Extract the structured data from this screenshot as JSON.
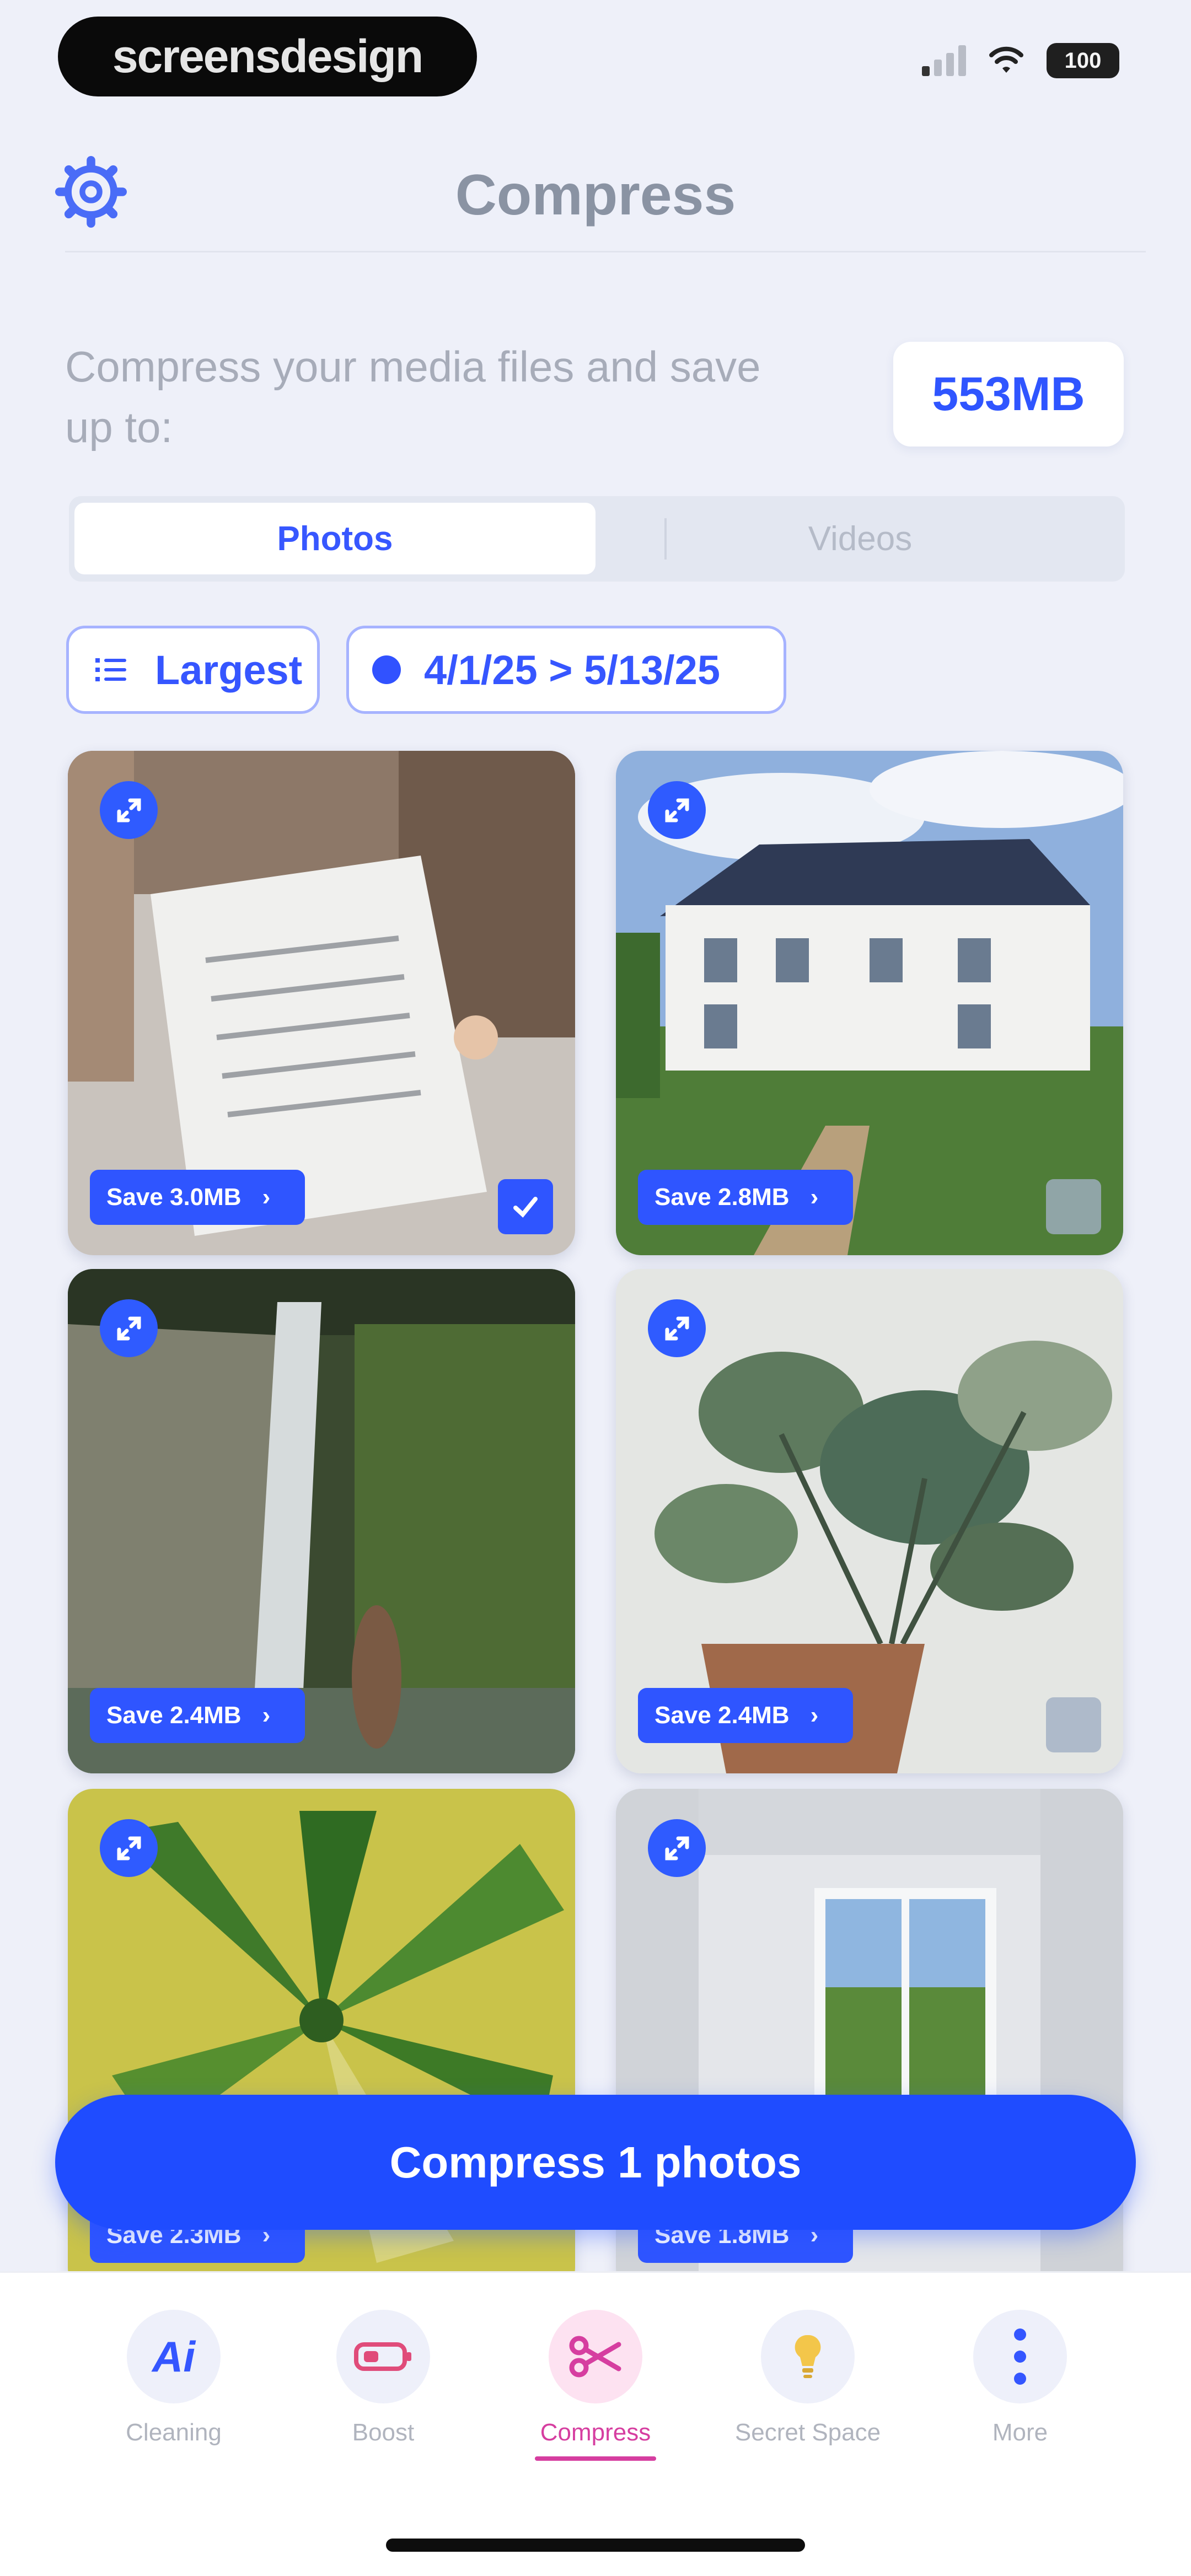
{
  "status_bar": {
    "brand": "screensdesign",
    "battery": "100"
  },
  "header": {
    "title": "Compress"
  },
  "savings": {
    "description": "Compress your media files and save up to:",
    "amount": "553MB"
  },
  "tabs": [
    {
      "label": "Photos",
      "active": true
    },
    {
      "label": "Videos",
      "active": false
    }
  ],
  "filters": {
    "sort_label": "Largest",
    "date_range": "4/1/25 > 5/13/25"
  },
  "photos": [
    {
      "save_label": "Save 3.0MB",
      "selected": true,
      "subject": "document"
    },
    {
      "save_label": "Save 2.8MB",
      "selected": false,
      "subject": "house"
    },
    {
      "save_label": "Save 2.4MB",
      "selected": false,
      "subject": "waterfall"
    },
    {
      "save_label": "Save 2.4MB",
      "selected": false,
      "subject": "plant"
    },
    {
      "save_label": "Save 2.3MB",
      "selected": false,
      "subject": "leaf"
    },
    {
      "save_label": "Save 1.8MB",
      "selected": false,
      "subject": "room"
    }
  ],
  "cta": {
    "label": "Compress 1 photos"
  },
  "nav": [
    {
      "label": "Cleaning",
      "icon": "ai-icon",
      "active": false
    },
    {
      "label": "Boost",
      "icon": "battery-icon",
      "active": false
    },
    {
      "label": "Compress",
      "icon": "scissors-icon",
      "active": true
    },
    {
      "label": "Secret Space",
      "icon": "lightbulb-icon",
      "active": false
    },
    {
      "label": "More",
      "icon": "more-icon",
      "active": false
    }
  ],
  "colors": {
    "accent": "#2f55ff",
    "active_nav": "#d63ea0",
    "background": "#eef0f9"
  }
}
